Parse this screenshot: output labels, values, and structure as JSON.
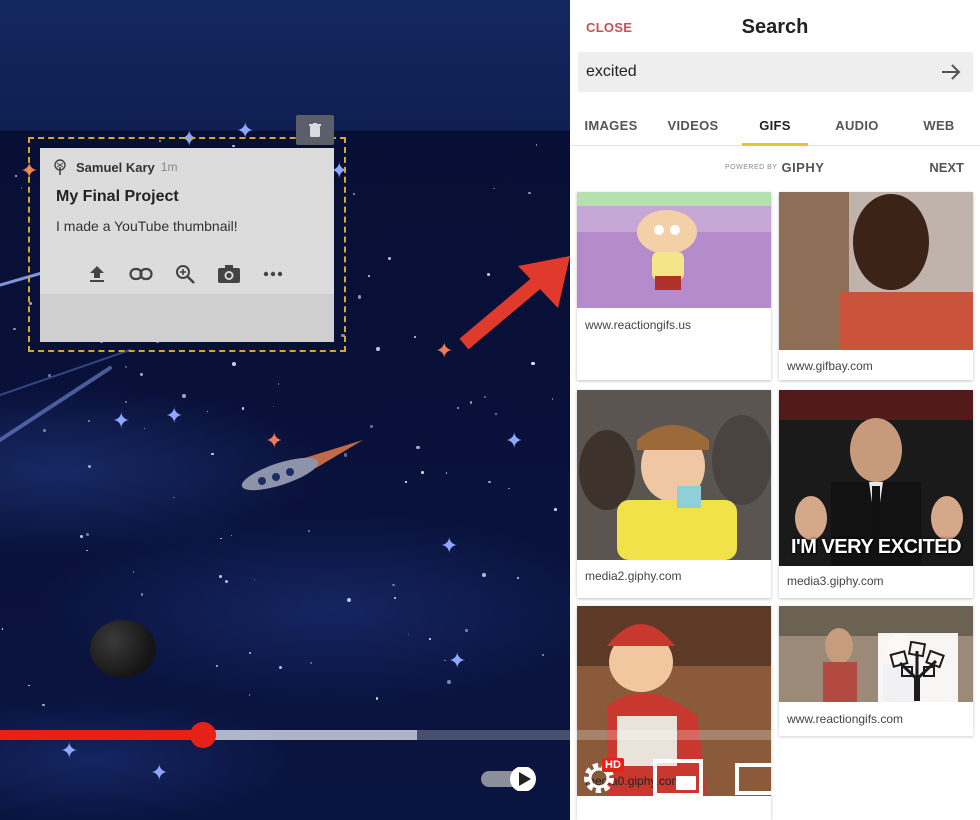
{
  "post": {
    "author": "Samuel Kary",
    "time": "1m",
    "title": "My Final Project",
    "body": "I made a YouTube thumbnail!",
    "actions": [
      "upload-icon",
      "link-icon",
      "zoom-icon",
      "camera-icon",
      "more-icon"
    ]
  },
  "search_panel": {
    "close_label": "CLOSE",
    "title": "Search",
    "query": "excited",
    "tabs": [
      {
        "label": "IMAGES",
        "active": false
      },
      {
        "label": "VIDEOS",
        "active": false
      },
      {
        "label": "GIFS",
        "active": true
      },
      {
        "label": "AUDIO",
        "active": false
      },
      {
        "label": "WEB",
        "active": false
      }
    ],
    "powered_prefix": "POWERED BY",
    "powered_brand": "GIPHY",
    "next_label": "NEXT",
    "results": [
      {
        "source": "www.reactiongifs.us"
      },
      {
        "source": "www.gifbay.com"
      },
      {
        "source": "media2.giphy.com"
      },
      {
        "source": "media3.giphy.com",
        "caption": "I'M VERY EXCITED"
      },
      {
        "source": "media0.giphy.com"
      },
      {
        "source": "www.reactiongifs.com"
      }
    ]
  },
  "player": {
    "played_fraction": 0.207,
    "buffered_fraction": 0.425,
    "hd_label": "HD",
    "accent": "#e62117"
  },
  "colors": {
    "selection_border": "#d6a630",
    "tab_underline": "#e8c32a",
    "close_text": "#c85050",
    "arrow": "#e03a2c"
  }
}
